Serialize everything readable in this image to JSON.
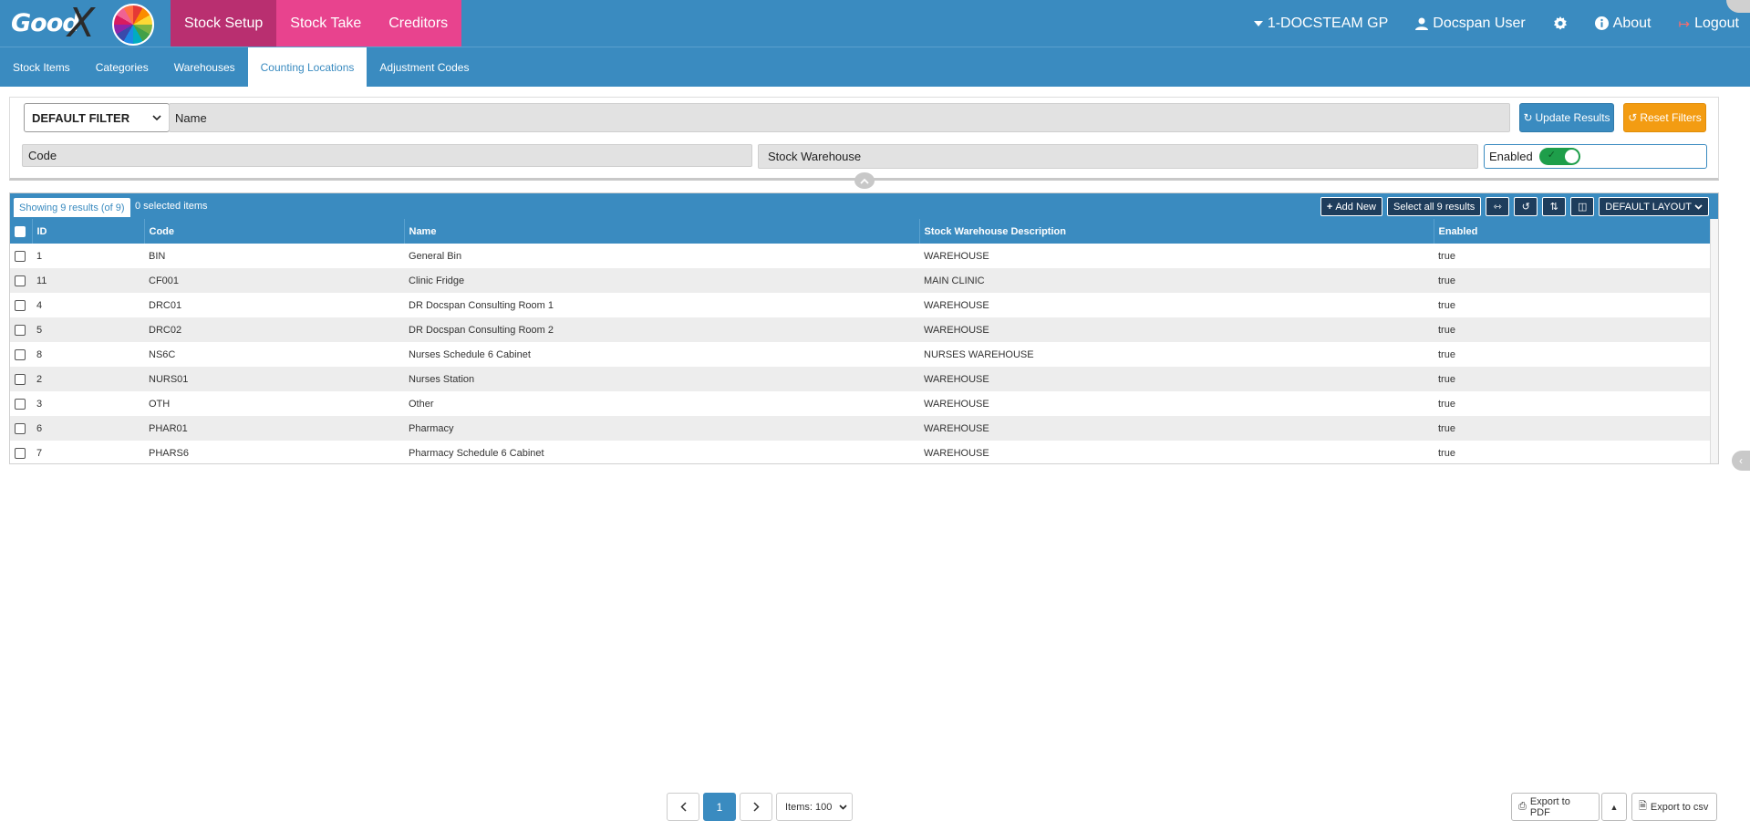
{
  "brand": {
    "logo_text": "Good",
    "logo_mark": "X"
  },
  "main_nav": [
    {
      "label": "Stock Setup",
      "active": true
    },
    {
      "label": "Stock Take",
      "active": false
    },
    {
      "label": "Creditors",
      "active": false
    }
  ],
  "user_nav": {
    "practice": "1-DOCSTEAM GP",
    "user": "Docspan User",
    "about": "About",
    "logout": "Logout"
  },
  "sub_nav": [
    {
      "label": "Stock Items",
      "active": false
    },
    {
      "label": "Categories",
      "active": false
    },
    {
      "label": "Warehouses",
      "active": false
    },
    {
      "label": "Counting Locations",
      "active": true
    },
    {
      "label": "Adjustment Codes",
      "active": false
    }
  ],
  "filters": {
    "filter_select": "DEFAULT FILTER",
    "name_placeholder": "Name",
    "code_placeholder": "Code",
    "warehouse_placeholder": "Stock Warehouse",
    "enabled_label": "Enabled",
    "enabled_value": true,
    "update_button": "Update Results",
    "reset_button": "Reset Filters"
  },
  "grid": {
    "showing": "Showing 9 results (of 9)",
    "selected": "0 selected items",
    "add_new": "Add New",
    "select_all": "Select all 9 results",
    "layout": "DEFAULT LAYOUT",
    "columns": [
      "ID",
      "Code",
      "Name",
      "Stock Warehouse Description",
      "Enabled"
    ],
    "rows": [
      [
        "1",
        "BIN",
        "General Bin",
        "WAREHOUSE",
        "true"
      ],
      [
        "11",
        "CF001",
        "Clinic Fridge",
        "MAIN CLINIC",
        "true"
      ],
      [
        "4",
        "DRC01",
        "DR Docspan Consulting Room 1",
        "WAREHOUSE",
        "true"
      ],
      [
        "5",
        "DRC02",
        "DR Docspan Consulting Room 2",
        "WAREHOUSE",
        "true"
      ],
      [
        "8",
        "NS6C",
        "Nurses Schedule 6 Cabinet",
        "NURSES WAREHOUSE",
        "true"
      ],
      [
        "2",
        "NURS01",
        "Nurses Station",
        "WAREHOUSE",
        "true"
      ],
      [
        "3",
        "OTH",
        "Other",
        "WAREHOUSE",
        "true"
      ],
      [
        "6",
        "PHAR01",
        "Pharmacy",
        "WAREHOUSE",
        "true"
      ],
      [
        "7",
        "PHARS6",
        "Pharmacy Schedule 6 Cabinet",
        "WAREHOUSE",
        "true"
      ]
    ]
  },
  "pagination": {
    "current_page": "1",
    "items_per_page": "Items: 100"
  },
  "export": {
    "pdf": "Export to PDF",
    "csv": "Export to csv"
  },
  "colors": {
    "primary": "#3a8bc0",
    "nav_pink": "#e8438e",
    "nav_active": "#b92f70",
    "reset": "#f39c12",
    "toggle_on": "#1e9e4a"
  }
}
